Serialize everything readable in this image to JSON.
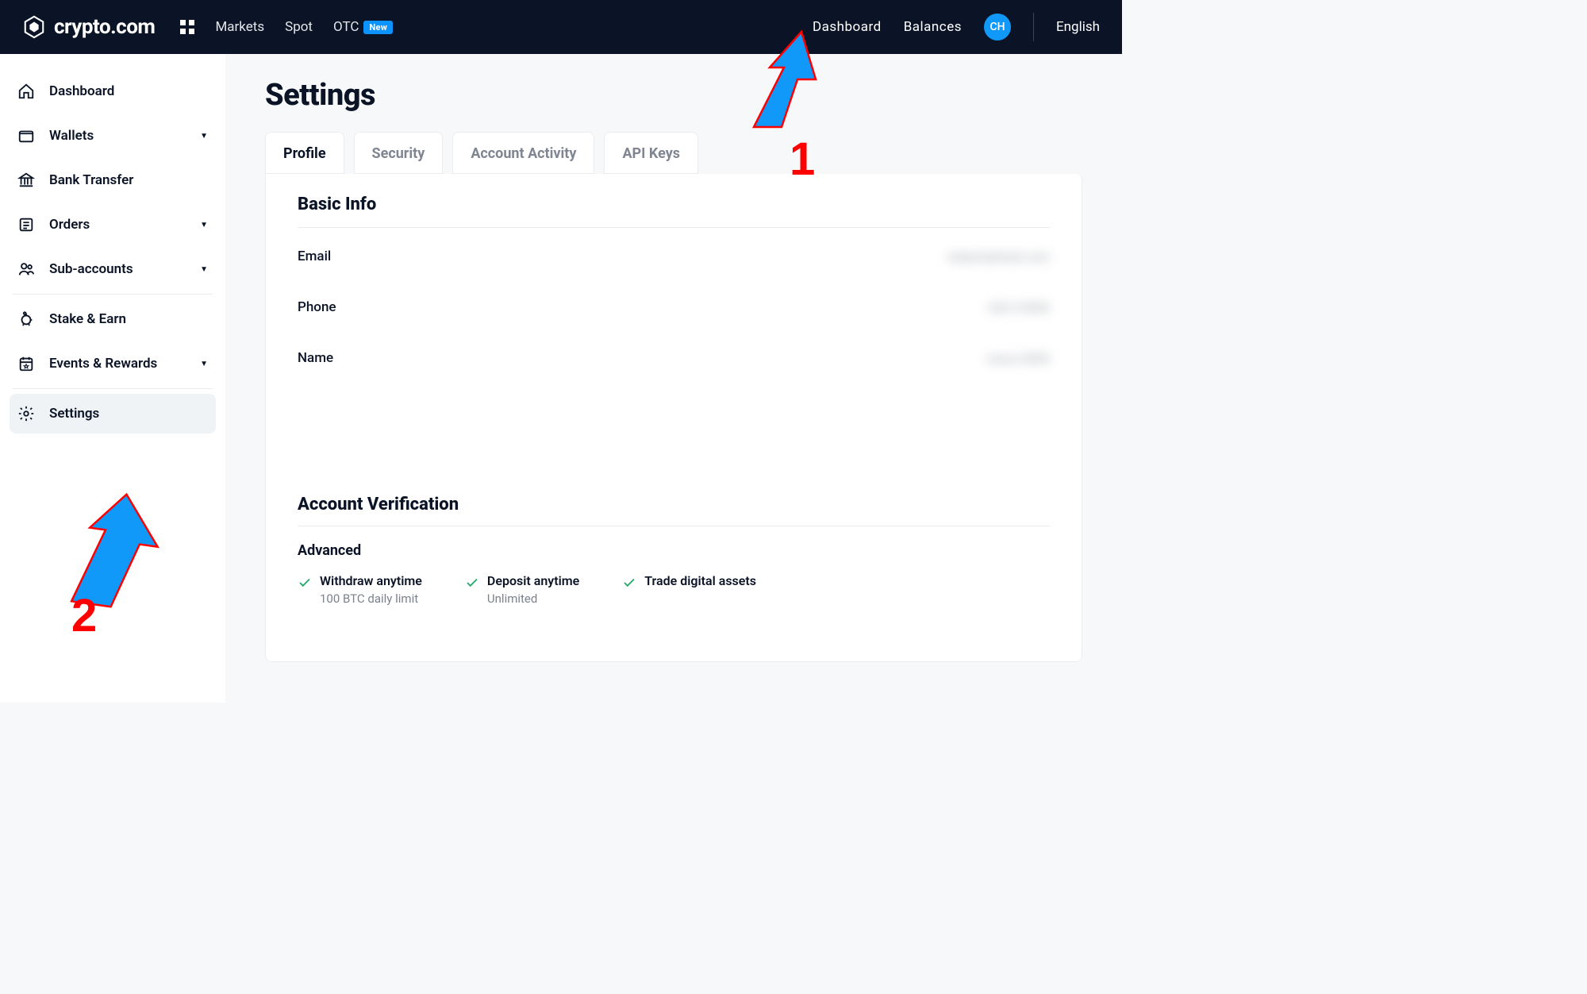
{
  "header": {
    "brand": "crypto.com",
    "nav": [
      {
        "label": "Markets"
      },
      {
        "label": "Spot"
      },
      {
        "label": "OTC",
        "badge": "New"
      }
    ],
    "right": {
      "dashboard": "Dashboard",
      "balances": "Balances",
      "avatar": "CH",
      "language": "English"
    }
  },
  "sidebar": {
    "items": [
      {
        "label": "Dashboard",
        "icon": "home",
        "expandable": false
      },
      {
        "label": "Wallets",
        "icon": "wallet",
        "expandable": true
      },
      {
        "label": "Bank Transfer",
        "icon": "bank",
        "expandable": false
      },
      {
        "label": "Orders",
        "icon": "orders",
        "expandable": true
      },
      {
        "label": "Sub-accounts",
        "icon": "users",
        "expandable": true
      },
      {
        "divider": true
      },
      {
        "label": "Stake & Earn",
        "icon": "piggy",
        "expandable": false
      },
      {
        "label": "Events & Rewards",
        "icon": "calendar",
        "expandable": true
      },
      {
        "divider": true
      },
      {
        "label": "Settings",
        "icon": "gear",
        "expandable": false,
        "active": true
      }
    ]
  },
  "page": {
    "title": "Settings",
    "tabs": [
      {
        "label": "Profile",
        "active": true
      },
      {
        "label": "Security"
      },
      {
        "label": "Account Activity"
      },
      {
        "label": "API Keys"
      }
    ],
    "basicInfo": {
      "title": "Basic Info",
      "rows": [
        {
          "label": "Email",
          "value": "redactedmail.com"
        },
        {
          "label": "Phone",
          "value": "+00 0 0000"
        },
        {
          "label": "Name",
          "value": "xxxxx 0000"
        }
      ]
    },
    "verification": {
      "title": "Account Verification",
      "level": "Advanced",
      "features": [
        {
          "title": "Withdraw anytime",
          "sub": "100 BTC daily limit"
        },
        {
          "title": "Deposit anytime",
          "sub": "Unlimited"
        },
        {
          "title": "Trade digital assets",
          "sub": ""
        }
      ]
    }
  },
  "annotations": {
    "arrow1_num": "1",
    "arrow2_num": "2"
  }
}
